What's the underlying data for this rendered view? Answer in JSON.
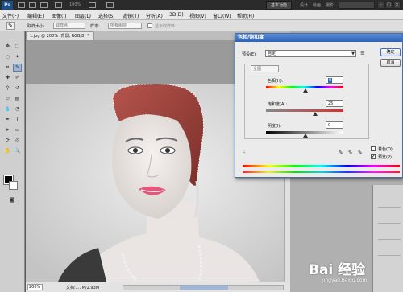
{
  "app": {
    "logo": "Ps",
    "zoom": "100%",
    "workspace_button": "基本功能",
    "workspace_links": [
      "设计",
      "绘画",
      "摄影"
    ]
  },
  "menu": {
    "items": [
      "文件(F)",
      "编辑(E)",
      "图像(I)",
      "图层(L)",
      "选择(S)",
      "滤镜(T)",
      "分析(A)",
      "3D(D)",
      "视图(V)",
      "窗口(W)",
      "帮助(H)"
    ]
  },
  "options_bar": {
    "feather_label": "取样大小:",
    "feather_value": "取样点",
    "style_label": "样本:",
    "style_value": "所有图层",
    "checkbox_label": "显示取样环"
  },
  "document": {
    "tab_title": "1.jpg @ 200% (背景, RGB/8) *",
    "zoom": "200%",
    "doc_info": "文档:1.7M/2.93M"
  },
  "dialog": {
    "title": "色相/饱和度",
    "preset_label": "预设(E):",
    "preset_value": "自定",
    "ok": "确定",
    "cancel": "取消",
    "channel": "全图",
    "hue_label": "色相(H):",
    "hue_value": "0",
    "sat_label": "饱和度(A):",
    "sat_value": "25",
    "light_label": "明度(I):",
    "light_value": "0",
    "colorize_label": "着色(O)",
    "preview_label": "预览(P)",
    "colorize_checked": false,
    "preview_checked": true
  },
  "watermark": {
    "brand": "Bai  经验",
    "url": "jingyan.baidu.com"
  },
  "colors": {
    "titlebar_blue": "#2d62b7",
    "foreground": "#000000",
    "background": "#ffffff"
  }
}
